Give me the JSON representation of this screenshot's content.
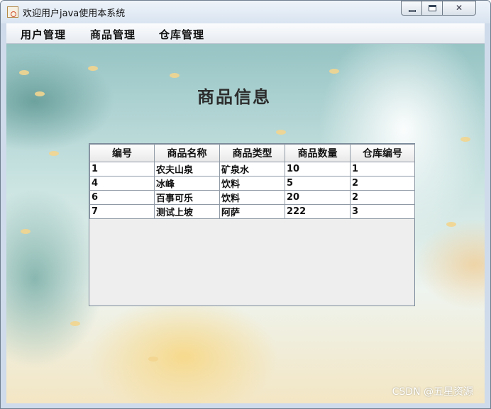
{
  "window": {
    "title": "欢迎用户java使用本系统",
    "controls": [
      "minimize-icon",
      "maximize-icon",
      "close-icon"
    ],
    "close_glyph": "✕"
  },
  "menu": {
    "items": [
      {
        "label": "用户管理"
      },
      {
        "label": "商品管理"
      },
      {
        "label": "仓库管理"
      }
    ]
  },
  "page": {
    "title": "商品信息"
  },
  "table": {
    "headers": [
      "编号",
      "商品名称",
      "商品类型",
      "商品数量",
      "仓库编号"
    ],
    "rows": [
      [
        "1",
        "农夫山泉",
        "矿泉水",
        "10",
        "1"
      ],
      [
        "4",
        "冰峰",
        "饮料",
        "5",
        "2"
      ],
      [
        "6",
        "百事可乐",
        "饮料",
        "20",
        "2"
      ],
      [
        "7",
        "测试上坡",
        "阿萨",
        "222",
        "3"
      ]
    ]
  },
  "watermark": "CSDN @五星资源",
  "colors": {
    "accent_leaf": "#f2d58f",
    "title_bar": "#d9e4f1"
  }
}
